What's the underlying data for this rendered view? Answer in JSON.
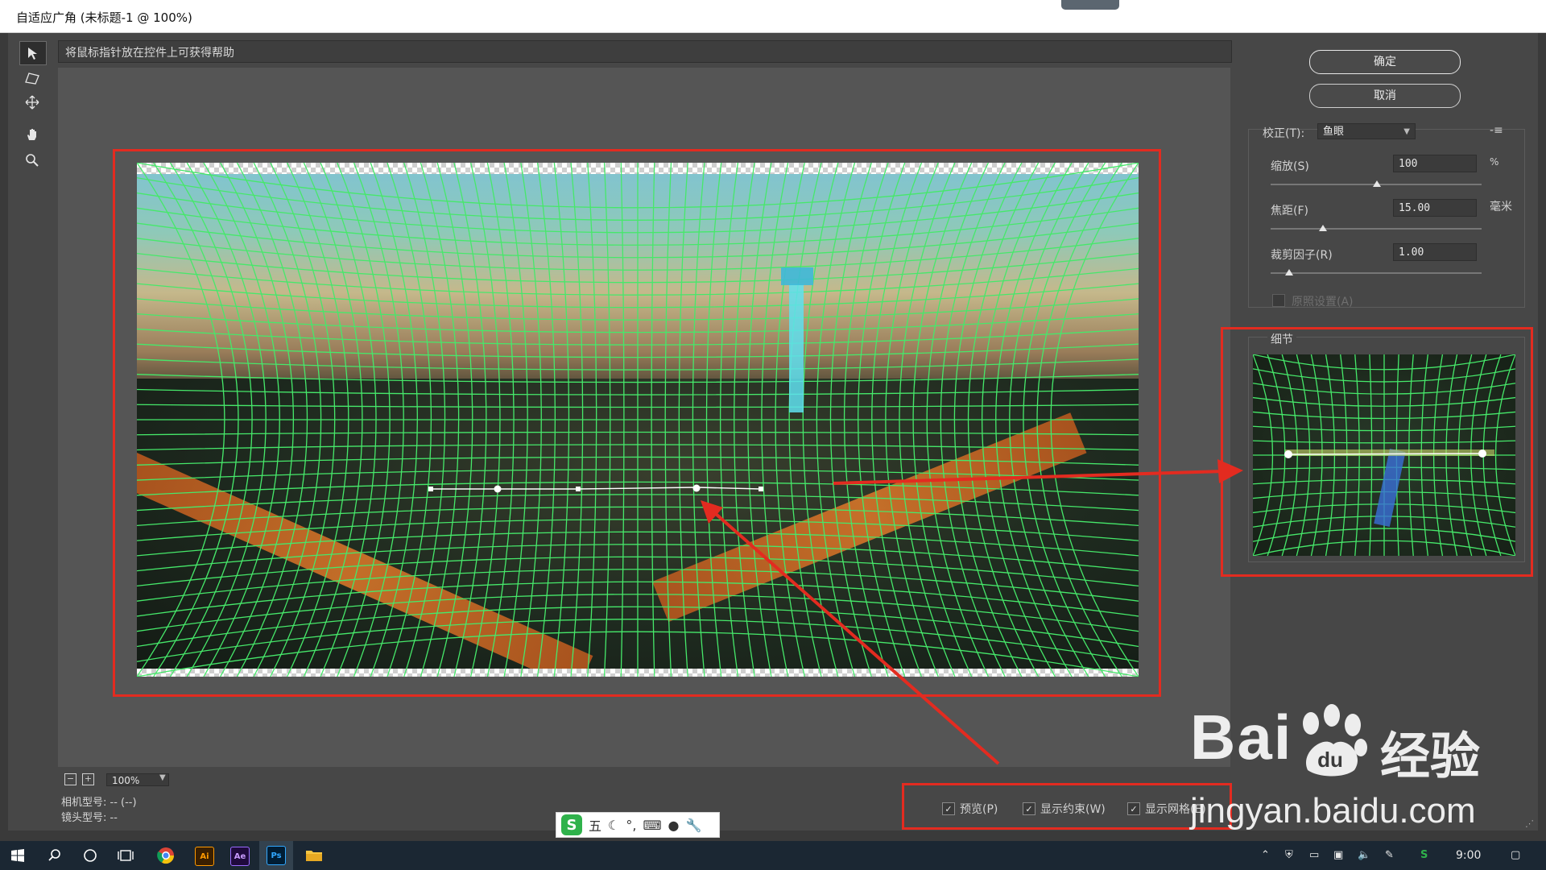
{
  "window": {
    "title": "自适应广角 (未标题-1 @ 100%)"
  },
  "hint": "将鼠标指针放在控件上可获得帮助",
  "buttons": {
    "ok": "确定",
    "cancel": "取消"
  },
  "correction": {
    "label": "校正(T):",
    "value": "鱼眼"
  },
  "scale": {
    "label": "缩放(S)",
    "value": "100",
    "unit": "%",
    "level": 0.5
  },
  "focal": {
    "label": "焦距(F)",
    "value": "15.00",
    "unit": "毫米",
    "level": 0.25
  },
  "crop": {
    "label": "裁剪因子(R)",
    "value": "1.00",
    "level": 0.1
  },
  "as_shot": {
    "label": "原照设置(A)"
  },
  "detail": {
    "label": "细节"
  },
  "zoom": {
    "value": "100%"
  },
  "camera": {
    "model": "相机型号: -- (--)",
    "lens": "镜头型号: --"
  },
  "options": {
    "preview": "预览(P)",
    "show_constraints": "显示约束(W)",
    "show_mesh": "显示网格(E)"
  },
  "ime": {
    "mode": "五"
  },
  "taskbar": {
    "time": "9:00"
  },
  "watermark": {
    "brand": "Bai",
    "brand2": "经验",
    "url": "jingyan.baidu.com"
  },
  "colors": {
    "annotation": "#e32b20",
    "mesh": "#46e86a",
    "panel": "#474747"
  }
}
